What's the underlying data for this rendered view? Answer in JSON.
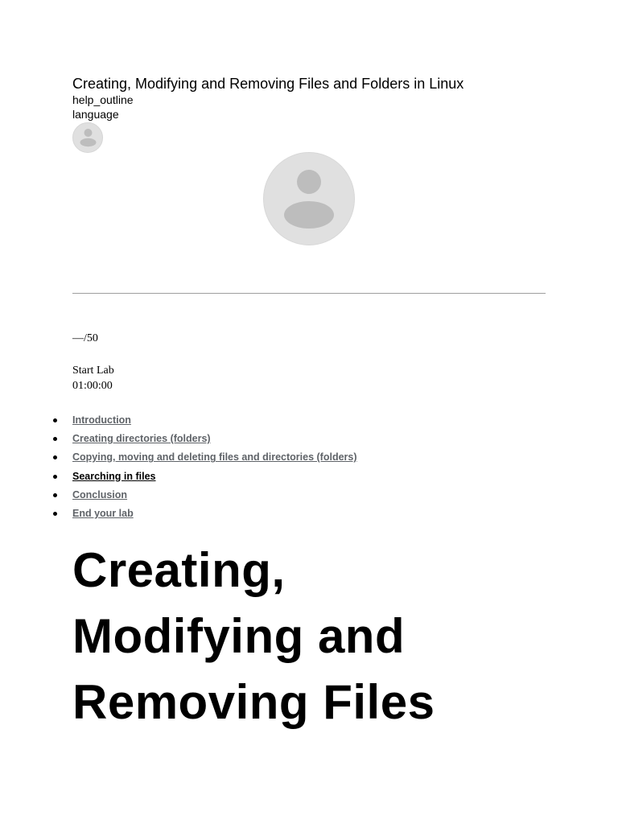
{
  "header": {
    "title": "Creating, Modifying and Removing Files and Folders in Linux",
    "help_icon_text": "help_outline",
    "language_icon_text": "language"
  },
  "lab": {
    "score": "—/50",
    "start_label": "Start Lab",
    "timer": "01:00:00"
  },
  "toc": {
    "items": [
      {
        "label": "Introduction",
        "active": false
      },
      {
        "label": "Creating directories (folders)",
        "active": false
      },
      {
        "label": "Copying, moving and deleting files and directories (folders)",
        "active": false
      },
      {
        "label": "Searching in files",
        "active": true
      },
      {
        "label": "Conclusion",
        "active": false
      },
      {
        "label": "End your lab",
        "active": false
      }
    ]
  },
  "content": {
    "heading_line_1": "Creating,",
    "heading_line_2": "Modifying and",
    "heading_line_3": "Removing Files"
  },
  "icons": {
    "avatar_small": "account-circle-icon",
    "avatar_large": "account-circle-icon"
  },
  "colors": {
    "avatar_bg": "#e0e0e0",
    "avatar_fg": "#bdbdbd",
    "link": "#5f6368",
    "active_link": "#000000",
    "divider": "#9e9e9e"
  }
}
